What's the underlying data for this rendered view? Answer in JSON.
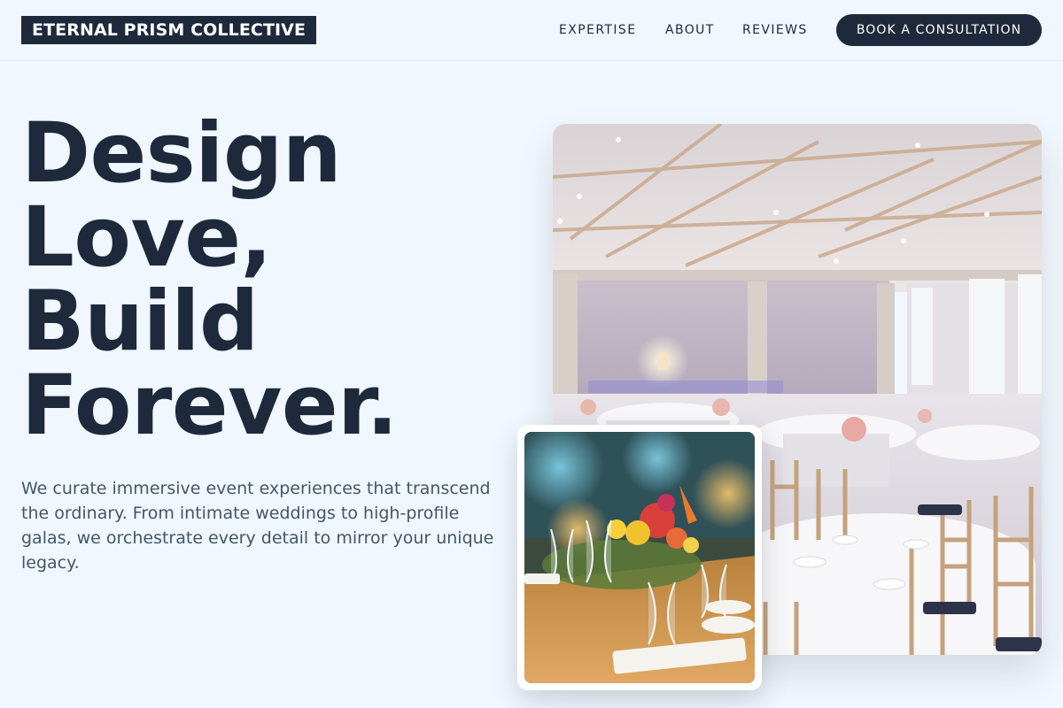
{
  "brand": {
    "name": "ETERNAL PRISM COLLECTIVE"
  },
  "nav": {
    "items": [
      {
        "label": "EXPERTISE"
      },
      {
        "label": "ABOUT"
      },
      {
        "label": "REVIEWS"
      }
    ],
    "cta_label": "BOOK A CONSULTATION"
  },
  "hero": {
    "headline_lines": [
      "Design",
      "Love,",
      "Build",
      "Forever."
    ],
    "description": "We curate immersive event experiences that transcend the ordinary. From intimate weddings to high-profile galas, we orchestrate every detail to mirror your unique legacy."
  },
  "images": {
    "main": {
      "icon": "banquet-hall-photo"
    },
    "inset": {
      "icon": "floral-centerpiece-photo"
    }
  },
  "colors": {
    "background": "#f0f7fe",
    "primary": "#1e293b",
    "body_text": "#475569",
    "header_border": "#dde6ef"
  }
}
